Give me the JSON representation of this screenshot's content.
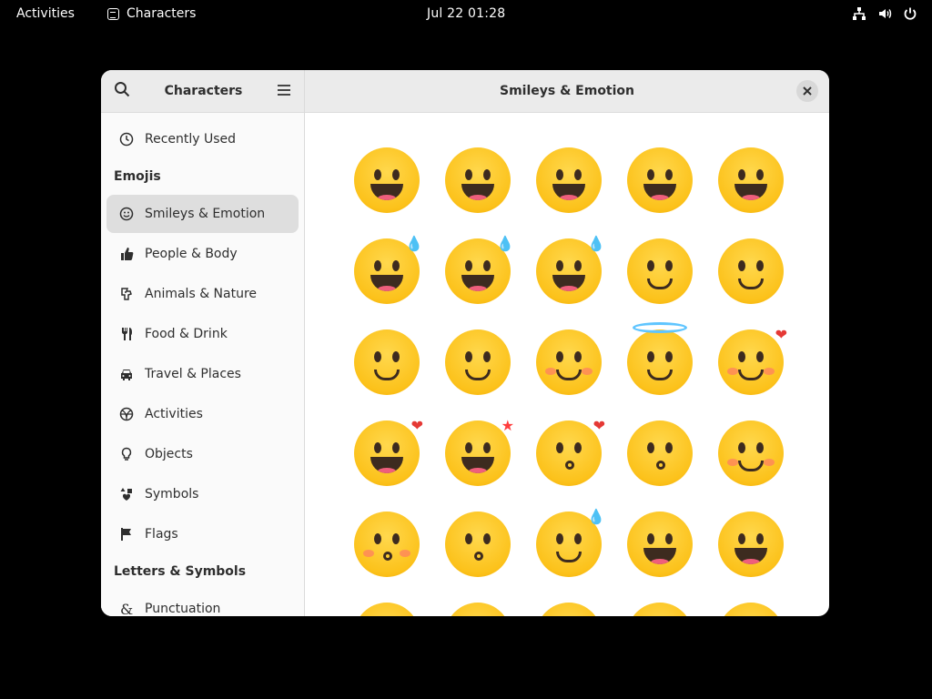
{
  "topbar": {
    "activities": "Activities",
    "app_name": "Characters",
    "clock": "Jul 22  01:28",
    "tray_icons": [
      "network-icon",
      "volume-icon",
      "power-icon"
    ]
  },
  "sidebar": {
    "title": "Characters",
    "items": [
      {
        "label": "Recently Used",
        "icon": "clock-icon",
        "type": "item"
      },
      {
        "label": "Emojis",
        "type": "section"
      },
      {
        "label": "Smileys & Emotion",
        "icon": "smiley-icon",
        "type": "item",
        "selected": true
      },
      {
        "label": "People & Body",
        "icon": "thumbs-up-icon",
        "type": "item"
      },
      {
        "label": "Animals & Nature",
        "icon": "animal-icon",
        "type": "item"
      },
      {
        "label": "Food & Drink",
        "icon": "utensils-icon",
        "type": "item"
      },
      {
        "label": "Travel & Places",
        "icon": "car-icon",
        "type": "item"
      },
      {
        "label": "Activities",
        "icon": "ball-icon",
        "type": "item"
      },
      {
        "label": "Objects",
        "icon": "lightbulb-icon",
        "type": "item"
      },
      {
        "label": "Symbols",
        "icon": "symbols-icon",
        "type": "item"
      },
      {
        "label": "Flags",
        "icon": "flag-icon",
        "type": "item"
      },
      {
        "label": "Letters & Symbols",
        "type": "section"
      },
      {
        "label": "Punctuation",
        "icon": "ampersand-icon",
        "type": "item"
      }
    ]
  },
  "content": {
    "title": "Smileys & Emotion",
    "emojis": [
      {
        "name": "grinning-face",
        "kind": "grin"
      },
      {
        "name": "grinning-face-big-eyes",
        "kind": "grin"
      },
      {
        "name": "grinning-face-smiling-eyes",
        "kind": "grin"
      },
      {
        "name": "beaming-face",
        "kind": "grin"
      },
      {
        "name": "grinning-squinting-face",
        "kind": "grin"
      },
      {
        "name": "grinning-face-sweat",
        "kind": "grin",
        "extra": "💧"
      },
      {
        "name": "rolling-on-floor-laughing",
        "kind": "grin",
        "extra": "💧"
      },
      {
        "name": "face-with-tears-of-joy",
        "kind": "grin",
        "extra": "💧"
      },
      {
        "name": "slightly-smiling-face",
        "kind": "smile"
      },
      {
        "name": "upside-down-face",
        "kind": "smile"
      },
      {
        "name": "melting-face",
        "kind": "smile"
      },
      {
        "name": "winking-face",
        "kind": "smile"
      },
      {
        "name": "smiling-face-smiling-eyes",
        "kind": "smile",
        "blush": true
      },
      {
        "name": "smiling-face-halo",
        "kind": "smile",
        "halo": true
      },
      {
        "name": "smiling-face-hearts",
        "kind": "smile",
        "extra": "❤",
        "blush": true
      },
      {
        "name": "heart-eyes",
        "kind": "grin",
        "extra": "❤"
      },
      {
        "name": "star-struck",
        "kind": "grin",
        "extra": "★"
      },
      {
        "name": "face-blowing-kiss",
        "kind": "kiss",
        "extra": "❤"
      },
      {
        "name": "kissing-face",
        "kind": "kiss"
      },
      {
        "name": "smiling-face",
        "kind": "smile",
        "blush": true
      },
      {
        "name": "kissing-face-closed-eyes",
        "kind": "kiss",
        "blush": true
      },
      {
        "name": "kissing-face-smiling-eyes",
        "kind": "kiss"
      },
      {
        "name": "smiling-face-tear",
        "kind": "smile",
        "extra": "💧"
      },
      {
        "name": "face-savoring-food",
        "kind": "tongue"
      },
      {
        "name": "face-with-tongue",
        "kind": "tongue"
      },
      {
        "name": "winking-face-tongue",
        "kind": "tongue"
      },
      {
        "name": "zany-face",
        "kind": "tongue"
      },
      {
        "name": "squinting-face-tongue",
        "kind": "tongue"
      },
      {
        "name": "money-mouth-face",
        "kind": "tongue"
      },
      {
        "name": "hugging-face",
        "kind": "smile"
      }
    ]
  }
}
